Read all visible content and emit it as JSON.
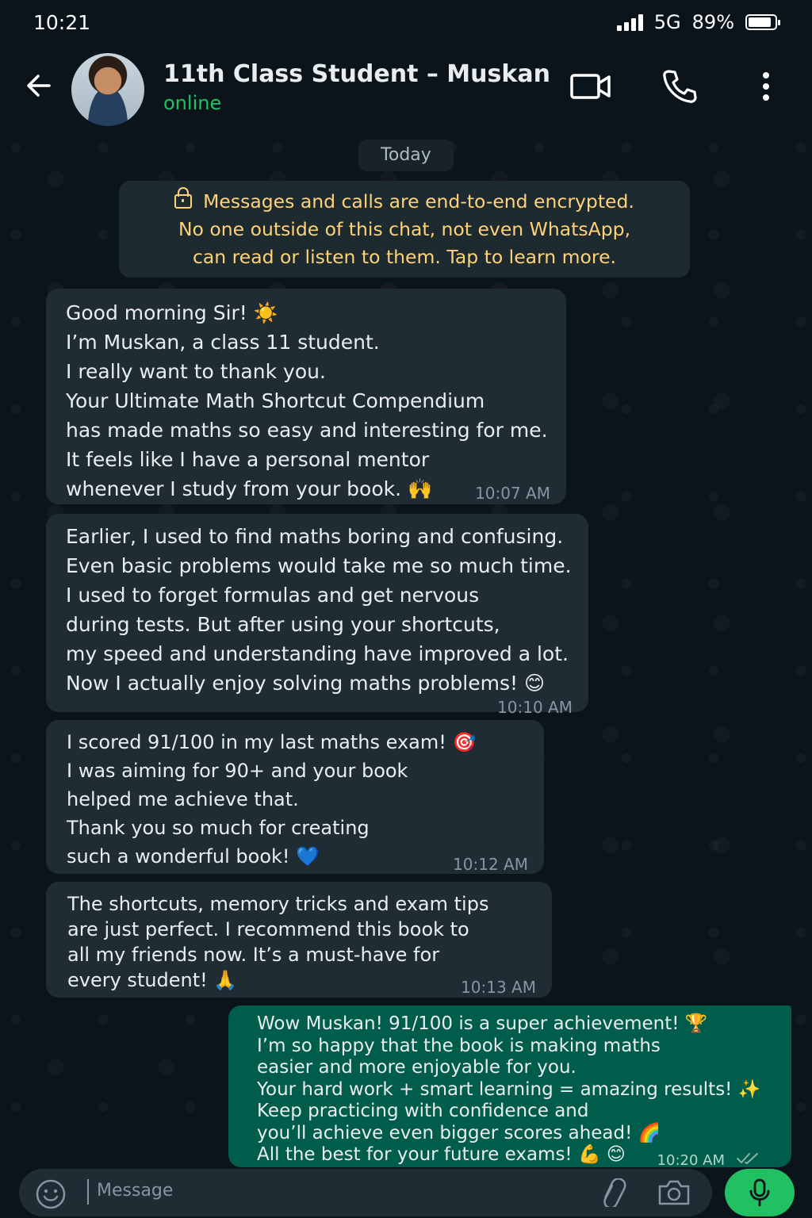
{
  "status_bar": {
    "time": "10:21",
    "network": "5G",
    "battery": "89%",
    "battery_level": 0.89
  },
  "header": {
    "contact_name": "11th Class Student – Muskan",
    "contact_status": "online",
    "icons": [
      "back-arrow-icon",
      "video-call-icon",
      "voice-call-icon",
      "more-options-icon"
    ]
  },
  "chat": {
    "date_label": "Today",
    "encryption_notice": [
      "Messages and calls are end-to-end encrypted.",
      "No one outside of this chat, not even WhatsApp,",
      "can read or listen to them. Tap to learn more."
    ],
    "messages": [
      {
        "direction": "incoming",
        "lines": [
          "Good morning Sir! ☀️",
          "I’m Muskan, a class 11 student.",
          "I really want to thank you.",
          "Your Ultimate Math Shortcut Compendium",
          "has made maths so easy and interesting for me.",
          "It feels like I have a personal mentor",
          "whenever I study from your book. 🙌"
        ],
        "time": "10:07 AM"
      },
      {
        "direction": "incoming",
        "lines": [
          "Earlier, I used to find maths boring and confusing.",
          "Even basic problems would take me so much time.",
          "I used to forget formulas and get nervous",
          "during tests. But after using your shortcuts,",
          "my speed and understanding have improved a lot.",
          "Now I actually enjoy solving maths problems! 😊"
        ],
        "time": "10:10 AM"
      },
      {
        "direction": "incoming",
        "lines": [
          "I scored 91/100 in my last maths exam! 🎯",
          "I was aiming for 90+ and your book",
          "helped me achieve that.",
          "Thank you so much for creating",
          "such a wonderful book! 💙"
        ],
        "time": "10:12 AM"
      },
      {
        "direction": "incoming",
        "lines": [
          "The shortcuts, memory tricks and exam tips",
          "are just perfect. I recommend this book to",
          "all my friends now. It’s a must-have for",
          "every student! 🙏"
        ],
        "time": "10:13 AM"
      },
      {
        "direction": "outgoing",
        "lines": [
          "Wow Muskan! 91/100 is a super achievement! 🏆",
          "I’m so happy that the book is making maths",
          "easier and more enjoyable for you.",
          "Your hard work + smart learning = amazing results! ✨",
          "Keep practicing with confidence and",
          "you’ll achieve even bigger scores ahead! 🌈",
          "All the best for your future exams! 💪 😊"
        ],
        "time": "10:20 AM",
        "read_status": "double-check-read-icon"
      }
    ]
  },
  "composer": {
    "placeholder": "Message",
    "icons": [
      "emoji-icon",
      "attach-icon",
      "camera-icon",
      "mic-icon"
    ]
  },
  "colors": {
    "background": "#0b141a",
    "incoming_bubble": "#1f2c34",
    "outgoing_bubble": "#005c4b",
    "accent_green": "#21c063",
    "encryption_text": "#ffd279"
  }
}
